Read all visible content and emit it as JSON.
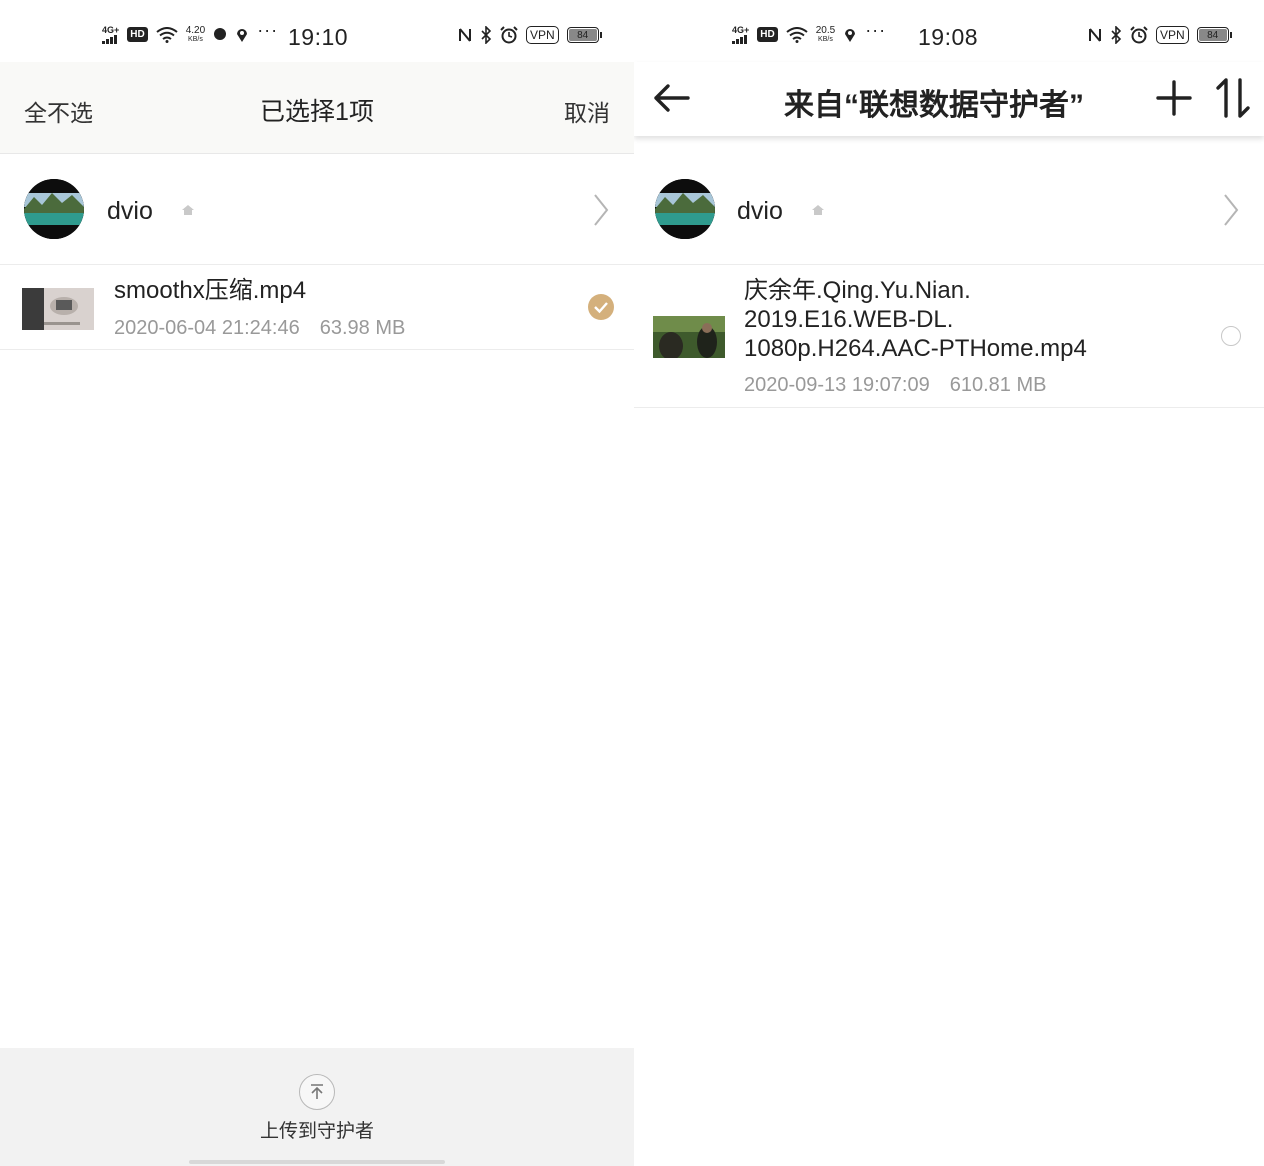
{
  "left_screen": {
    "status_bar": {
      "network": "4G+",
      "hd": "HD",
      "speed_value": "4.20",
      "speed_unit": "KB/s",
      "time": "19:10",
      "vpn": "VPN",
      "battery": "84",
      "battery_level": 0.84
    },
    "header": {
      "deselect_all": "全不选",
      "title": "已选择1项",
      "cancel": "取消"
    },
    "device": {
      "name": "dvio"
    },
    "file": {
      "name": "smoothx压缩.mp4",
      "date": "2020-06-04 21:24:46",
      "size": "63.98 MB",
      "selected": true
    },
    "bottom_bar": {
      "upload_label": "上传到守护者"
    }
  },
  "right_screen": {
    "status_bar": {
      "network": "4G+",
      "hd": "HD",
      "speed_value": "20.5",
      "speed_unit": "KB/s",
      "time": "19:08",
      "vpn": "VPN",
      "battery": "84",
      "battery_level": 0.84
    },
    "header": {
      "title": "来自“联想数据守护者”"
    },
    "device": {
      "name": "dvio"
    },
    "file": {
      "name_line1": "庆余年.Qing.Yu.Nian.",
      "name_line2": "2019.E16.WEB-DL.",
      "name_line3": "1080p.H264.AAC-PTHome.mp4",
      "date": "2020-09-13 19:07:09",
      "size": "610.81 MB",
      "selected": false
    }
  },
  "colors": {
    "accent_check": "#d4b07c",
    "meta_text": "#999999",
    "header_bg": "#f9f9f7",
    "bottom_bar_bg": "#f2f2f2"
  },
  "icons": [
    "signal-icon",
    "wifi-icon",
    "location-icon",
    "nfc-icon",
    "bluetooth-icon",
    "alarm-icon",
    "back-arrow-icon",
    "plus-icon",
    "sort-icon",
    "chevron-right-icon",
    "upload-icon",
    "check-icon"
  ]
}
